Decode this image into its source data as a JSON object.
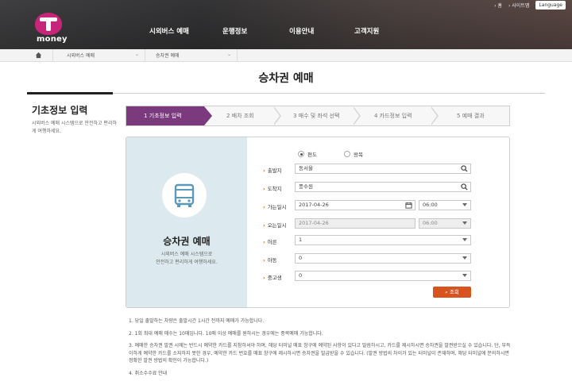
{
  "header": {
    "logo_word": "money",
    "util": {
      "home": "홈",
      "sitemap": "사이트맵",
      "language": "Language"
    },
    "nav": [
      "시외버스 예매",
      "운행정보",
      "이용안내",
      "고객지원"
    ]
  },
  "breadcrumb": {
    "level1": "시외버스 예매",
    "level2": "승차권 예매"
  },
  "page_title": "승차권 예매",
  "side": {
    "heading": "기초정보 입력",
    "desc": "시외버스 예매 시스템으로 안전하고 편리하게 여행하세요."
  },
  "steps": [
    {
      "label": "1 기초정보 입력"
    },
    {
      "label": "2 배차 조회"
    },
    {
      "label": "3 매수 및 좌석 선택"
    },
    {
      "label": "4 카드정보 입력"
    },
    {
      "label": "5 예매 결과"
    }
  ],
  "panel": {
    "title": "승차권 예매",
    "desc_line1": "시외버스 예매 시스템으로",
    "desc_line2": "안전하고 편리하게 여행하세요."
  },
  "form": {
    "trip_oneway": "편도",
    "trip_round": "왕복",
    "departure_label": "출발지",
    "departure_value": "동서울",
    "arrival_label": "도착지",
    "arrival_value": "풍수원",
    "go_label": "가는일시",
    "go_date": "2017-04-26",
    "go_time": "06:00",
    "return_label": "오는일시",
    "return_date": "2017-04-26",
    "return_time": "06:00",
    "adult_label": "어른",
    "adult_value": "1",
    "child_label": "아동",
    "child_value": "0",
    "teen_label": "중고생",
    "teen_value": "0",
    "search_button": "조회"
  },
  "notes": [
    "1. 당일 출발하는 차량은 출발시간 1시간 전까지 예매가 가능합니다.",
    "2. 1회 최대 예매 매수는 10매입니다. 10매 이상 예매를 원하시는 경우에는 중복예매 가능합니다.",
    "3. 예매한 승차권 발권 시에는 반드시 예약한 카드를 지참하셔야 하며, 해당 터미널 매표 창구에 예약된 사항이 있다고 말씀하시고, 카드를 제시하시면 승차권을 발권받으실 수 있습니다. 단, 부득이하게 예약한 카드를 소지하지 못한 경우, 예약한 카드 번호를 매표 창구에 제시하시면 승차권을 발급받을 수 있습니다. (발권 방법의 차이가 있는 터미널이 존재하며, 해당 터미널에 문의하시면 정확한 발권 방법의 확인이 가능합니다.)",
    "4. 취소수수료 안내"
  ],
  "colors": {
    "accent_purple": "#7b3a7d",
    "search_orange": "#d9531e",
    "panel_blue": "#dce9ee"
  }
}
